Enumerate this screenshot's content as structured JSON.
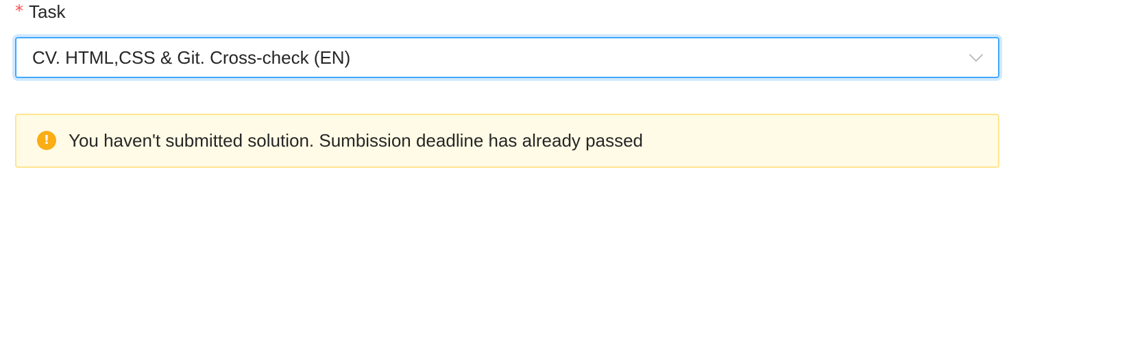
{
  "task_field": {
    "required_mark": "*",
    "label": "Task",
    "selected_value": "CV. HTML,CSS & Git. Cross-check (EN)",
    "dropdown_icon": "chevron-down-icon"
  },
  "alert": {
    "type": "warning",
    "icon": "exclamation-circle-icon",
    "icon_glyph": "!",
    "message": "You haven't submitted solution. Sumbission deadline has already passed"
  },
  "colors": {
    "required": "#ff4d4f",
    "focus_border": "#40a9ff",
    "warning_bg": "#fffbe6",
    "warning_border": "#ffe58f",
    "warning_icon": "#faad14"
  }
}
